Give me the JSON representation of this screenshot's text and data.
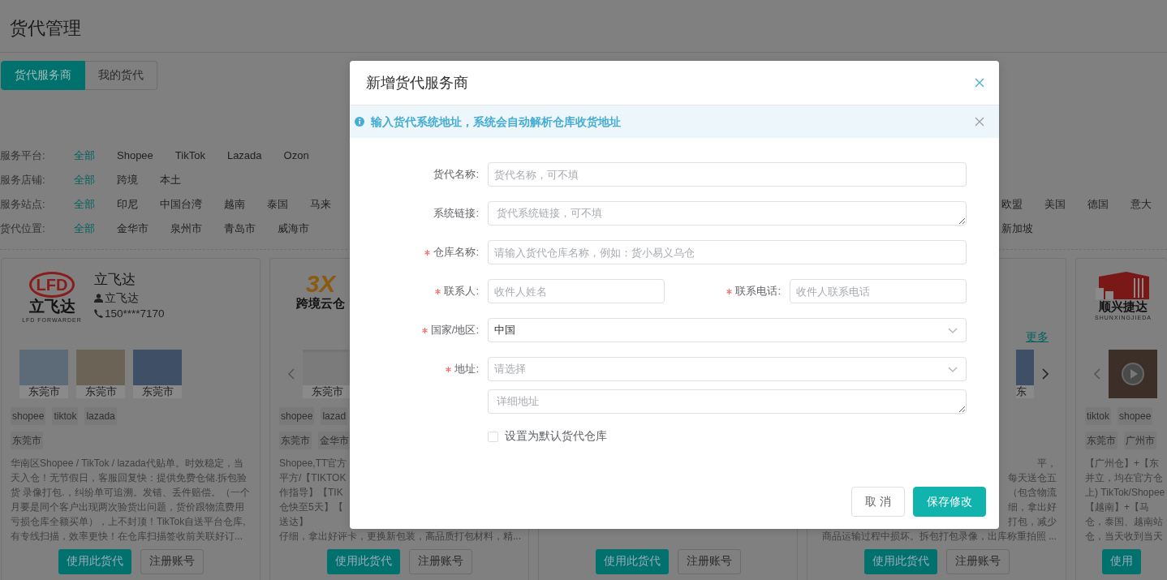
{
  "page": {
    "title": "货代管理"
  },
  "tabs": [
    {
      "label": "货代服务商",
      "selected": true
    },
    {
      "label": "我的货代",
      "selected": false
    }
  ],
  "filters": [
    {
      "label": "服务平台:",
      "options": [
        {
          "label": "全部",
          "selected": true
        },
        {
          "label": "Shopee",
          "selected": false
        },
        {
          "label": "TikTok",
          "selected": false
        },
        {
          "label": "Lazada",
          "selected": false
        },
        {
          "label": "Ozon",
          "selected": false
        }
      ]
    },
    {
      "label": "服务店铺:",
      "options": [
        {
          "label": "全部",
          "selected": true
        },
        {
          "label": "跨境",
          "selected": false
        },
        {
          "label": "本土",
          "selected": false
        }
      ]
    },
    {
      "label": "服务站点:",
      "options": [
        {
          "label": "全部",
          "selected": true
        },
        {
          "label": "印尼",
          "selected": false
        },
        {
          "label": "中国台湾",
          "selected": false
        },
        {
          "label": "越南",
          "selected": false
        },
        {
          "label": "泰国",
          "selected": false
        },
        {
          "label": "马来",
          "selected": false
        }
      ],
      "options_right": [
        {
          "label": "欧盟",
          "selected": false
        },
        {
          "label": "美国",
          "selected": false
        },
        {
          "label": "德国",
          "selected": false
        },
        {
          "label": "意大",
          "selected": false
        }
      ]
    },
    {
      "label": "货代位置:",
      "options": [
        {
          "label": "全部",
          "selected": true
        },
        {
          "label": "金华市",
          "selected": false
        },
        {
          "label": "泉州市",
          "selected": false
        },
        {
          "label": "青岛市",
          "selected": false
        },
        {
          "label": "威海市",
          "selected": false
        }
      ],
      "options_right": [
        {
          "label": "新加坡",
          "selected": false
        }
      ]
    }
  ],
  "cards": [
    {
      "logo": {
        "kind": "ring",
        "mark": "LFD",
        "name": "立飞达",
        "sub": "LFD FORWARDER"
      },
      "name": "立飞达",
      "contact": "立飞达",
      "phone": "150****7170",
      "photos": [
        {
          "kind": "truck",
          "caption": "东莞市"
        },
        {
          "kind": "shelves",
          "caption": "东莞市"
        },
        {
          "kind": "racks",
          "caption": "东莞市"
        }
      ],
      "tags": [
        "shopee",
        "tiktok",
        "lazada"
      ],
      "locations": [
        "东莞市"
      ],
      "description": "华南区Shopee / TikTok / lazada代贴单。时效稳定，当天入仓！无节假日，客服回复快：提供免费仓储.拆包验货 录像打包.，纠纷单可追溯。发错、丢件赔偿。（一个月要是同个客户出现两次验货出问题，货价跟物流费用亏损仓库全额买单），上不封顶！TikTok自送平台仓库,有专线扫描，效率更快！在仓库扫描签收前关联好订...",
      "buttons": [
        "使用此货代",
        "注册账号"
      ]
    },
    {
      "logo": {
        "kind": "italic",
        "mark": "3X",
        "name": "跨境云仓"
      },
      "prev_arrow": true,
      "photos": [
        {
          "kind": "document",
          "caption": "东莞市"
        }
      ],
      "tags": [
        "shopee",
        "lazad"
      ],
      "locations": [
        "东莞市",
        "金华市"
      ],
      "description_lines": [
        "Shopee,TT官方",
        "平方/【TIKTOK",
        "作指导】【TIK",
        "仓快至5天】【",
        "送达】",
        "仔细，拿出好评卡，更换新包装，高品质打包材料，精..."
      ],
      "buttons": [
        "使用此货代",
        "注册账号"
      ]
    },
    {
      "buttons": [
        "使用此货代",
        "注册账号"
      ]
    },
    {
      "more_link": "更多",
      "photos": [
        {
          "kind": "racks",
          "caption": "东"
        }
      ],
      "next_arrow": true,
      "description_lines": [
        "平，",
        "每天送仓五",
        "（包含物流",
        "细，拿出好",
        "打包，减少",
        "商品运输过程中损坏。拆包打包录像，出库称重拍照 ..."
      ],
      "buttons": [
        "使用此货代",
        "注册账号"
      ]
    },
    {
      "logo": {
        "kind": "building",
        "name": "顺兴捷达",
        "sub": "SHUNXINGJIEDA"
      },
      "prev_arrow": true,
      "photos": [
        {
          "kind": "video"
        }
      ],
      "tags": [
        "tiktok",
        "shopee"
      ],
      "locations": [
        "东莞市",
        "广州市"
      ],
      "description_lines": [
        "【广州仓】+【东",
        "并立，均在官方仓",
        "上) TikTok/Shopee",
        "【越南】+【马",
        "仓，泰国、越南站",
        "仓，当天收到当天"
      ],
      "buttons": [
        "使用"
      ]
    }
  ],
  "dialog": {
    "title": "新增货代服务商",
    "alert": "输入货代系统地址，系统会自动解析仓库收货地址",
    "fields": [
      {
        "kind": "input",
        "label": "货代名称:",
        "required": false,
        "placeholder": "货代名称，可不填"
      },
      {
        "kind": "textarea",
        "label": "系统链接:",
        "required": false,
        "placeholder": "货代系统链接，可不填"
      },
      {
        "kind": "input",
        "label": "仓库名称:",
        "required": true,
        "placeholder": "请输入货代仓库名称，例如：货小易义乌仓"
      },
      {
        "kind": "pair",
        "items": [
          {
            "label": "联系人:",
            "required": true,
            "placeholder": "收件人姓名"
          },
          {
            "label": "联系电话:",
            "required": true,
            "placeholder": "收件人联系电话"
          }
        ]
      },
      {
        "kind": "select",
        "label": "国家/地区:",
        "required": true,
        "value": "中国"
      },
      {
        "kind": "select",
        "label": "地址:",
        "required": true,
        "placeholder": "请选择"
      },
      {
        "kind": "textarea",
        "placeholder": "详细地址"
      },
      {
        "kind": "checkbox",
        "text": "设置为默认货代仓库",
        "checked": false
      }
    ],
    "buttons": [
      {
        "kind": "secondary",
        "label": "取 消"
      },
      {
        "kind": "primary",
        "label": "保存修改"
      }
    ]
  }
}
